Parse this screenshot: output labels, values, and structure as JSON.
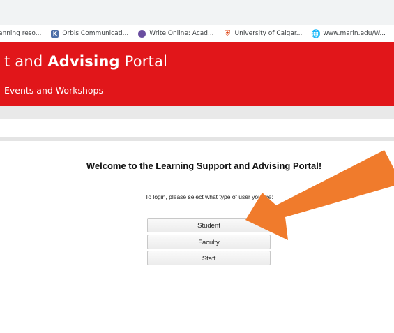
{
  "bookmarks": [
    {
      "label": "anning reso...",
      "icon": "none"
    },
    {
      "label": "Orbis Communicati...",
      "icon": "k-logo-icon"
    },
    {
      "label": "Write Online: Acad...",
      "icon": "write-online-icon"
    },
    {
      "label": "University of Calgar...",
      "icon": "shield-icon"
    },
    {
      "label": "www.marin.edu/W...",
      "icon": "globe-icon"
    }
  ],
  "banner": {
    "title_prefix": "t and ",
    "title_bold": "Advising",
    "title_suffix": " Portal",
    "subtitle": "Events and Workshops",
    "color": "#e1161a"
  },
  "main": {
    "welcome": "Welcome to the Learning Support and Advising Portal!",
    "instruction": "To login, please select what type of user you are:",
    "buttons": [
      "Student",
      "Faculty",
      "Staff"
    ]
  },
  "annotation": {
    "arrow_color": "#f07b2c"
  }
}
